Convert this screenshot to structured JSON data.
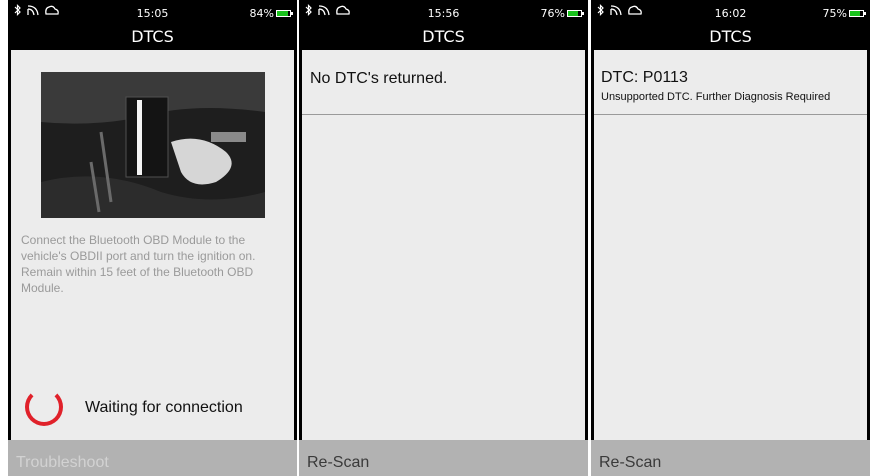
{
  "screens": [
    {
      "status": {
        "time": "15:05",
        "battery": "84%",
        "battery_level": 0.84
      },
      "title": "DTCS",
      "instructions": "Connect the Bluetooth OBD Module to the vehicle's OBDII port and turn the ignition on. Remain within 15 feet of the Bluetooth OBD Module.",
      "waiting_text": "Waiting for connection",
      "bottom_button": "Troubleshoot"
    },
    {
      "status": {
        "time": "15:56",
        "battery": "76%",
        "battery_level": 0.76
      },
      "title": "DTCS",
      "message": "No DTC's returned.",
      "bottom_button": "Re-Scan"
    },
    {
      "status": {
        "time": "16:02",
        "battery": "75%",
        "battery_level": 0.75
      },
      "title": "DTCS",
      "dtc_code": "DTC: P0113",
      "dtc_description": "Unsupported DTC. Further Diagnosis Required",
      "bottom_button": "Re-Scan"
    }
  ],
  "colors": {
    "accent_spinner": "#e0212a",
    "battery_green": "#19c21c",
    "content_bg": "#ececec",
    "bottom_bar": "#b2b2b2"
  },
  "icons": [
    "bluetooth-icon",
    "signal-icon",
    "cloud-icon",
    "battery-icon",
    "loading-spinner-icon"
  ]
}
